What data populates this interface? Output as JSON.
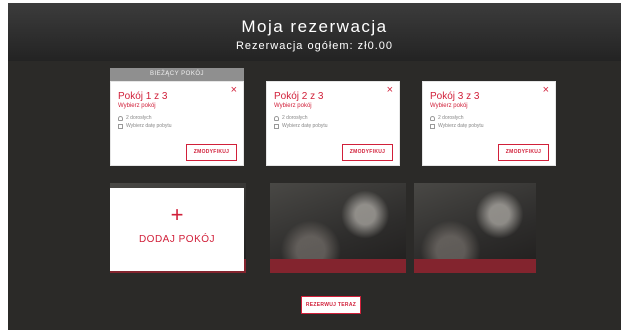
{
  "header": {
    "logo_text": "",
    "title": "Moja rezerwacja",
    "subtitle": "Rezerwacja ogółem: zł0.00"
  },
  "current_room_tab": "BIEŻĄCY POKÓJ",
  "rooms": [
    {
      "title": "Pokój 1 z 3",
      "subtitle": "Wybierz pokój",
      "guests": "2 dorosłych",
      "dates": "Wybierz datę pobytu",
      "change_label": "ZMODYFIKUJ",
      "close_label": "×"
    },
    {
      "title": "Pokój 2 z 3",
      "subtitle": "Wybierz pokój",
      "guests": "2 dorosłych",
      "dates": "Wybierz datę pobytu",
      "change_label": "ZMODYFIKUJ",
      "close_label": "×"
    },
    {
      "title": "Pokój 3 z 3",
      "subtitle": "Wybierz pokój",
      "guests": "2 dorosłych",
      "dates": "Wybierz datę pobytu",
      "change_label": "ZMODYFIKUJ",
      "close_label": "×"
    }
  ],
  "add_room": {
    "plus": "+",
    "label": "DODAJ POKÓJ"
  },
  "reserve_button": "REZERWUJ TERAZ",
  "colors": {
    "accent": "#d1203a",
    "background": "#2b2a28",
    "card": "#ffffff"
  },
  "icons": [
    "person-icon",
    "calendar-icon",
    "close-icon",
    "plus-icon"
  ]
}
